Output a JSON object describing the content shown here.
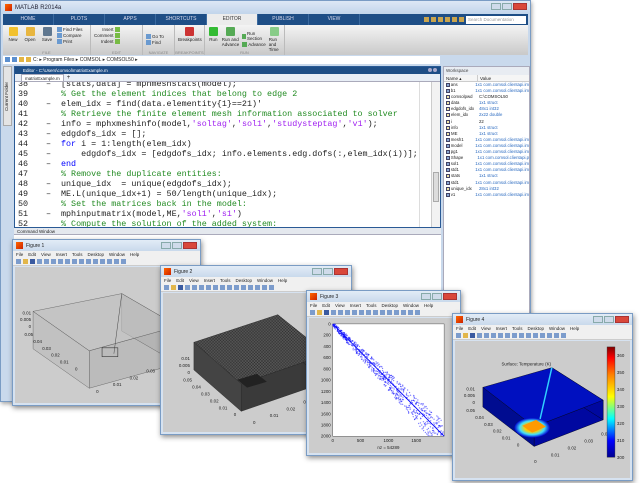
{
  "app": {
    "title": "MATLAB R2014a"
  },
  "tabs": [
    {
      "label": "HOME"
    },
    {
      "label": "PLOTS"
    },
    {
      "label": "APPS"
    },
    {
      "label": "SHORTCUTS"
    },
    {
      "label": "EDITOR",
      "active": true
    },
    {
      "label": "PUBLISH"
    },
    {
      "label": "VIEW"
    }
  ],
  "search": {
    "placeholder": "Search Documentation"
  },
  "toolstrip": {
    "file": {
      "label": "FILE",
      "new": "New",
      "open": "Open",
      "save": "Save",
      "find_files": "Find Files",
      "compare": "Compare",
      "print": "Print"
    },
    "edit": {
      "label": "EDIT",
      "insert": "Insert",
      "comment": "Comment",
      "indent": "Indent"
    },
    "navigate": {
      "label": "NAVIGATE",
      "goto": "Go To",
      "find": "Find"
    },
    "breakpoints": {
      "label": "BREAKPOINTS",
      "breakpoints": "Breakpoints"
    },
    "run": {
      "label": "RUN",
      "run": "Run",
      "run_advance": "Run and Advance",
      "run_section": "Run Section",
      "advance": "Advance",
      "run_time": "Run and Time"
    }
  },
  "address": {
    "path": [
      "C:",
      "Program Files",
      "COMSOL",
      "COMSOL50"
    ]
  },
  "current_folder": {
    "label": "Current Folder"
  },
  "editor": {
    "title": "Editor - C:\\Users\\comsol\\matrixExample.m",
    "file_tab": "matrixExample.m",
    "lines": [
      {
        "n": "38",
        "bp": true,
        "tokens": [
          {
            "t": "[stats,data] = mphmeshstats(model);",
            "c": ""
          }
        ]
      },
      {
        "n": "39",
        "bp": false,
        "tokens": [
          {
            "t": "% Get the element indices that belong to edge 2",
            "c": "cm"
          }
        ]
      },
      {
        "n": "40",
        "bp": true,
        "tokens": [
          {
            "t": "elem_idx = find(data.elementity{1}==21)'",
            "c": ""
          }
        ]
      },
      {
        "n": "41",
        "bp": false,
        "tokens": [
          {
            "t": "% Retrieve the finite element mesh information associated to solver",
            "c": "cm"
          }
        ]
      },
      {
        "n": "42",
        "bp": true,
        "tokens": [
          {
            "t": "info = mphxmeshinfo(model,",
            "c": ""
          },
          {
            "t": "'soltag'",
            "c": "str"
          },
          {
            "t": ",",
            "c": ""
          },
          {
            "t": "'sol1'",
            "c": "str"
          },
          {
            "t": ",",
            "c": ""
          },
          {
            "t": "'studysteptag'",
            "c": "str"
          },
          {
            "t": ",",
            "c": ""
          },
          {
            "t": "'v1'",
            "c": "str"
          },
          {
            "t": ");",
            "c": ""
          }
        ]
      },
      {
        "n": "43",
        "bp": true,
        "tokens": [
          {
            "t": "edgdofs_idx = [];",
            "c": ""
          }
        ]
      },
      {
        "n": "44",
        "bp": true,
        "tokens": [
          {
            "t": "for",
            "c": "kw"
          },
          {
            "t": " i = 1:length(elem_idx)",
            "c": ""
          }
        ]
      },
      {
        "n": "45",
        "bp": true,
        "tokens": [
          {
            "t": "    edgdofs_idx = [edgdofs_idx; info.elements.edg.dofs(:,elem_idx(i))];",
            "c": ""
          }
        ]
      },
      {
        "n": "46",
        "bp": true,
        "tokens": [
          {
            "t": "end",
            "c": "kw"
          }
        ]
      },
      {
        "n": "47",
        "bp": false,
        "tokens": [
          {
            "t": "% Remove the duplicate entities:",
            "c": "cm"
          }
        ]
      },
      {
        "n": "48",
        "bp": true,
        "tokens": [
          {
            "t": "unique_idx  = unique(edgdofs_idx);",
            "c": ""
          }
        ]
      },
      {
        "n": "49",
        "bp": true,
        "tokens": [
          {
            "t": "ME.L(unique_idx+1) = 50/length(unique_idx);",
            "c": ""
          }
        ]
      },
      {
        "n": "50",
        "bp": false,
        "tokens": [
          {
            "t": "% Set the matrices back in the model:",
            "c": "cm"
          }
        ]
      },
      {
        "n": "51",
        "bp": true,
        "tokens": [
          {
            "t": "mphinputmatrix(model,ME,",
            "c": ""
          },
          {
            "t": "'sol1'",
            "c": "str"
          },
          {
            "t": ",",
            "c": ""
          },
          {
            "t": "'s1'",
            "c": "str"
          },
          {
            "t": ")",
            "c": ""
          }
        ]
      },
      {
        "n": "52",
        "bp": false,
        "tokens": [
          {
            "t": "% Compute the solution of the added system:",
            "c": "cm"
          }
        ]
      }
    ]
  },
  "command_window": {
    "label": "Command Window"
  },
  "workspace": {
    "title": "Workspace",
    "col_name": "Name ▴",
    "col_value": "Value",
    "vars": [
      {
        "name": "ans",
        "value": "1x1 com.comsol.clientapi.im",
        "obj": true
      },
      {
        "name": "b1",
        "value": "1x1 com.comsol.clientapi.im",
        "obj": true
      },
      {
        "name": "comsolpwd",
        "value": "C:\\COMSOL50",
        "plain": true
      },
      {
        "name": "data",
        "value": "1x1 struct"
      },
      {
        "name": "edgdofs_idx",
        "value": "48x1 int32"
      },
      {
        "name": "elem_idx",
        "value": "2x22 double"
      },
      {
        "name": "i",
        "value": "22",
        "plain": true
      },
      {
        "name": "info",
        "value": "1x1 struct"
      },
      {
        "name": "ME",
        "value": "1x1 struct"
      },
      {
        "name": "mesh1",
        "value": "1x1 com.comsol.clientapi.im",
        "obj": true
      },
      {
        "name": "model",
        "value": "1x1 com.comsol.clientapi.im",
        "obj": true
      },
      {
        "name": "pg1",
        "value": "1x1 com.comsol.clientapi.im",
        "obj": true
      },
      {
        "name": "Shape",
        "value": "1x1 com.comsol.clientapi.p",
        "obj": true
      },
      {
        "name": "sol1",
        "value": "1x1 com.comsol.clientapi.im",
        "obj": true
      },
      {
        "name": "std1",
        "value": "1x1 com.comsol.clientapi.im",
        "obj": true
      },
      {
        "name": "stats",
        "value": "1x1 struct"
      },
      {
        "name": "std1",
        "value": "1x1 com.comsol.clientapi.im",
        "obj": true
      },
      {
        "name": "unique_idx",
        "value": "28x1 int32"
      },
      {
        "name": "v1",
        "value": "1x1 com.comsol.clientapi.im",
        "obj": true
      }
    ]
  },
  "figure_menu": [
    "File",
    "Edit",
    "View",
    "Insert",
    "Tools",
    "Desktop",
    "Window",
    "Help"
  ],
  "figures": [
    {
      "title": "Figure 1",
      "z_ticks": [
        "0.01",
        "0.005",
        "0"
      ],
      "y_ticks": [
        "0.05",
        "0.04",
        "0.03",
        "0.02",
        "0.01",
        "0"
      ],
      "x_ticks": [
        "0",
        "0.01",
        "0.02",
        "0.03"
      ]
    },
    {
      "title": "Figure 2",
      "z_ticks": [
        "0.01",
        "0.005",
        "0"
      ],
      "y_ticks": [
        "0.05",
        "0.04",
        "0.03",
        "0.02",
        "0.01",
        "0"
      ],
      "x_ticks": [
        "0",
        "0.01",
        "0.02",
        "0.03"
      ]
    },
    {
      "title": "Figure 3",
      "xlabel": "nz = 54289",
      "x_ticks": [
        "0",
        "500",
        "1000",
        "1500"
      ],
      "y_ticks": [
        "0",
        "200",
        "400",
        "600",
        "800",
        "1000",
        "1200",
        "1400",
        "1600",
        "1800",
        "2000"
      ],
      "marker_color": "#0000ff"
    },
    {
      "title": "Figure 4",
      "plot_title": "Surface: Temperature (K)",
      "z_ticks": [
        "0.01",
        "0.005",
        "0"
      ],
      "y_ticks": [
        "0.05",
        "0.04",
        "0.03",
        "0.02",
        "0.01",
        "0"
      ],
      "x_ticks": [
        "0",
        "0.01",
        "0.02",
        "0.03",
        "0.04"
      ],
      "colorbar_ticks": [
        "360",
        "350",
        "340",
        "330",
        "320",
        "310",
        "300"
      ]
    }
  ],
  "chart_data": [
    {
      "type": "scatter",
      "title": "",
      "xlabel": "nz = 54289",
      "ylabel": "",
      "xlim": [
        0,
        2000
      ],
      "ylim": [
        2000,
        0
      ],
      "note_band": "banded sparsity pattern along diagonal"
    },
    {
      "type": "heatmap",
      "title": "Surface: Temperature (K)",
      "colorbar_range": [
        300,
        365
      ],
      "colorbar_ticks": [
        300,
        310,
        320,
        330,
        340,
        350,
        360
      ]
    }
  ]
}
